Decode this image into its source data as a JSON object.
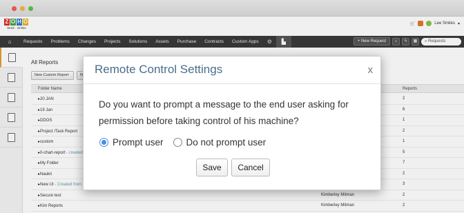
{
  "window": {
    "controls": [
      "close",
      "minimize",
      "maximize"
    ]
  },
  "header": {
    "logo_letters": [
      "Z",
      "O",
      "H",
      "O"
    ],
    "logo_colors": [
      "#d7302a",
      "#4aa147",
      "#2d7bc4",
      "#e8b323"
    ],
    "logo_subtitle": "Work · Online",
    "user_name": "Lee Smiles"
  },
  "nav": {
    "items": [
      "Requests",
      "Problems",
      "Changes",
      "Projects",
      "Solutions",
      "Assets",
      "Purchase",
      "Contracts",
      "Custom Apps"
    ],
    "new_request_label": "+ New Request",
    "search_placeholder": "Requests"
  },
  "sidebar": {
    "icons": [
      "reports-icon",
      "user-icon",
      "server-icon",
      "schedule-report-icon",
      "report-settings-icon"
    ]
  },
  "main": {
    "title": "All Reports",
    "new_custom_report_label": "New Custom Report",
    "second_button_label": "N",
    "columns": [
      "Folder Name",
      "Reports"
    ],
    "rows": [
      {
        "folder": "20 JAN",
        "note": "",
        "owner": "",
        "count": "2"
      },
      {
        "folder": "19 Jan",
        "note": "",
        "owner": "",
        "count": "6"
      },
      {
        "folder": "DDOS",
        "note": "",
        "owner": "",
        "count": "1"
      },
      {
        "folder": "Project /Task Report",
        "note": "",
        "owner": "",
        "count": "2"
      },
      {
        "folder": "custom",
        "note": "",
        "owner": "",
        "count": "1"
      },
      {
        "folder": "0-chart-report",
        "note": " - created",
        "owner": "",
        "count": "5"
      },
      {
        "folder": "My Folder",
        "note": "",
        "owner": "",
        "count": "7"
      },
      {
        "folder": "Naukri",
        "note": "",
        "owner": "",
        "count": "2"
      },
      {
        "folder": "New UI",
        "note": " - Created from N",
        "owner": "",
        "count": "3"
      },
      {
        "folder": "Secure test",
        "note": "",
        "owner": "Kimberley Mitman",
        "count": "2"
      },
      {
        "folder": "Kim Reports",
        "note": "",
        "owner": "Kimberley Mitman",
        "count": "2"
      }
    ]
  },
  "dialog": {
    "title": "Remote Control Settings",
    "close_glyph": "x",
    "message_line1": "Do you want to prompt a message to the end user asking for",
    "message_line2": "permission before taking control of his machine?",
    "options": [
      {
        "label": "Prompt user",
        "selected": true
      },
      {
        "label": "Do not prompt user",
        "selected": false
      }
    ],
    "save_label": "Save",
    "cancel_label": "Cancel",
    "accent_color": "#4a90e2"
  }
}
